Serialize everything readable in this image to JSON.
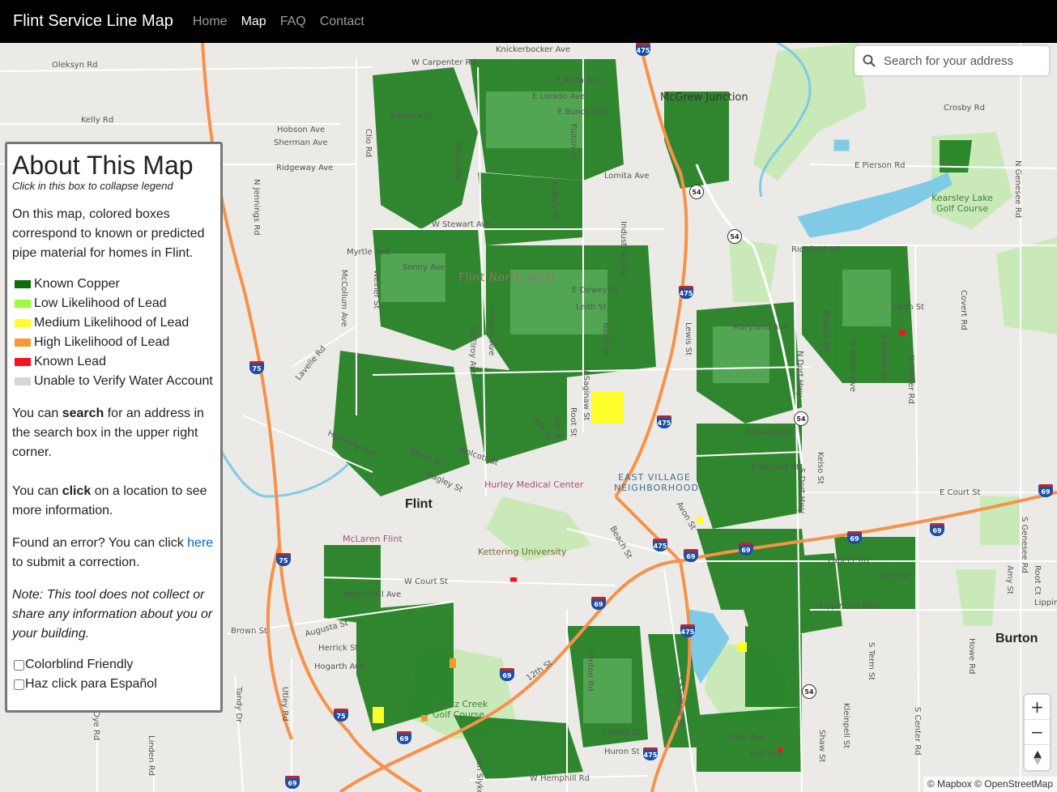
{
  "navbar": {
    "brand": "Flint Service Line Map",
    "links": [
      {
        "label": "Home",
        "active": false
      },
      {
        "label": "Map",
        "active": true
      },
      {
        "label": "FAQ",
        "active": false
      },
      {
        "label": "Contact",
        "active": false
      }
    ]
  },
  "search": {
    "placeholder": "Search for your address",
    "icon": "search-icon"
  },
  "legend": {
    "title": "About This Map",
    "subtitle": "Click in this box to collapse legend",
    "intro": "On this map, colored boxes correspond to known or predicted pipe material for homes in Flint.",
    "items": [
      {
        "label": "Known Copper",
        "color": "#0b6e0b"
      },
      {
        "label": "Low Likelihood of Lead",
        "color": "#9afc3a"
      },
      {
        "label": "Medium Likelihood of Lead",
        "color": "#fdfd2a"
      },
      {
        "label": "High Likelihood of Lead",
        "color": "#f7982d"
      },
      {
        "label": "Known Lead",
        "color": "#f8121e"
      },
      {
        "label": "Unable to Verify Water Account",
        "color": "#d6d6d6"
      }
    ],
    "search_text_pre": "You can ",
    "search_text_bold": "search",
    "search_text_post": " for an address in the search box in the upper right corner.",
    "click_text_pre": "You can ",
    "click_text_bold": "click",
    "click_text_post": " on a location to see more information.",
    "error_text_pre": "Found an error? You can click ",
    "error_link": "here",
    "error_text_post": " to submit a correction.",
    "note": "Note: This tool does not collect or share any information about you or your building.",
    "colorblind_label": "Colorblind Friendly",
    "spanish_label": "Haz click para Español"
  },
  "zoom": {
    "in": "+",
    "out": "−",
    "compass": "compass-icon"
  },
  "attribution": "© Mapbox © OpenStreetMap",
  "map_labels": {
    "streets": [
      "Oleksyn Rd",
      "Kelly Rd",
      "Hobson Ave",
      "Sherman Ave",
      "Ridgeway Ave",
      "N Jennings Rd",
      "Clio Rd",
      "W Carpenter Rd",
      "Knickerbocker Ave",
      "E Alma Ave",
      "E Lorado Ave",
      "E Bundy Ave",
      "Barbara Dr",
      "Olean Ave",
      "Fulton St",
      "Lomita Ave",
      "Aubrey St",
      "W Stewart Ave",
      "Myrtle Ave",
      "Sonny Ave",
      "McColIum Ave",
      "Weiner St",
      "Lavelle Rd",
      "Iroquois Ave",
      "McElroy Ave",
      "E Dewey St",
      "Leith St",
      "Industrial Ave",
      "North St",
      "N Saginaw St",
      "Lyon St",
      "Root St",
      "Ave B",
      "Hatherly Ave",
      "Wolcott St",
      "Sloan St",
      "Bagley St",
      "W Court St",
      "Mann Hall Ave",
      "Brown St",
      "Augusta St",
      "Herrick St",
      "Hogarth Ave",
      "Tandy Dr",
      "Utley Rd",
      "Dye Rd",
      "Linden Rd",
      "12th St",
      "Fenton Rd",
      "Van Slyke",
      "W Hemphill Rd",
      "Leland St",
      "Huron St",
      "S Saginaw St",
      "Beach St",
      "Avon St",
      "E Second St",
      "Kansas Ave",
      "Maryland Ave",
      "Lewis St",
      "N Dort Hwy",
      "Kelso St",
      "S Dort Hwy",
      "E Court St",
      "Lapeer Rd",
      "Lippincott Blvd",
      "Kent St",
      "S Term St",
      "Kleinpell St",
      "Shaw St",
      "Lake Ave",
      "Dell Ave",
      "Richfield Rd",
      "E Pierson Rd",
      "Crosby Rd",
      "Leith St",
      "Branch Rd",
      "N Averill Ave",
      "N Dexter St",
      "N Center Rd",
      "S Center Rd",
      "N Genesee Rd",
      "Covert Rd",
      "Amy St",
      "Root Ct",
      "S Genesee Rd",
      "Howe Rd",
      "Lippin"
    ],
    "places": [
      "McGrew Junction",
      "Flint North-West",
      "Hurley Medical Center",
      "EAST VILLAGE NEIGHBORHOOD",
      "Flint",
      "McLaren Flint",
      "Kettering University",
      "Swartz Creek Golf Course",
      "Kearsley Lake Golf Course",
      "Burton"
    ],
    "highway_shields": [
      "475",
      "54",
      "75",
      "69"
    ]
  }
}
